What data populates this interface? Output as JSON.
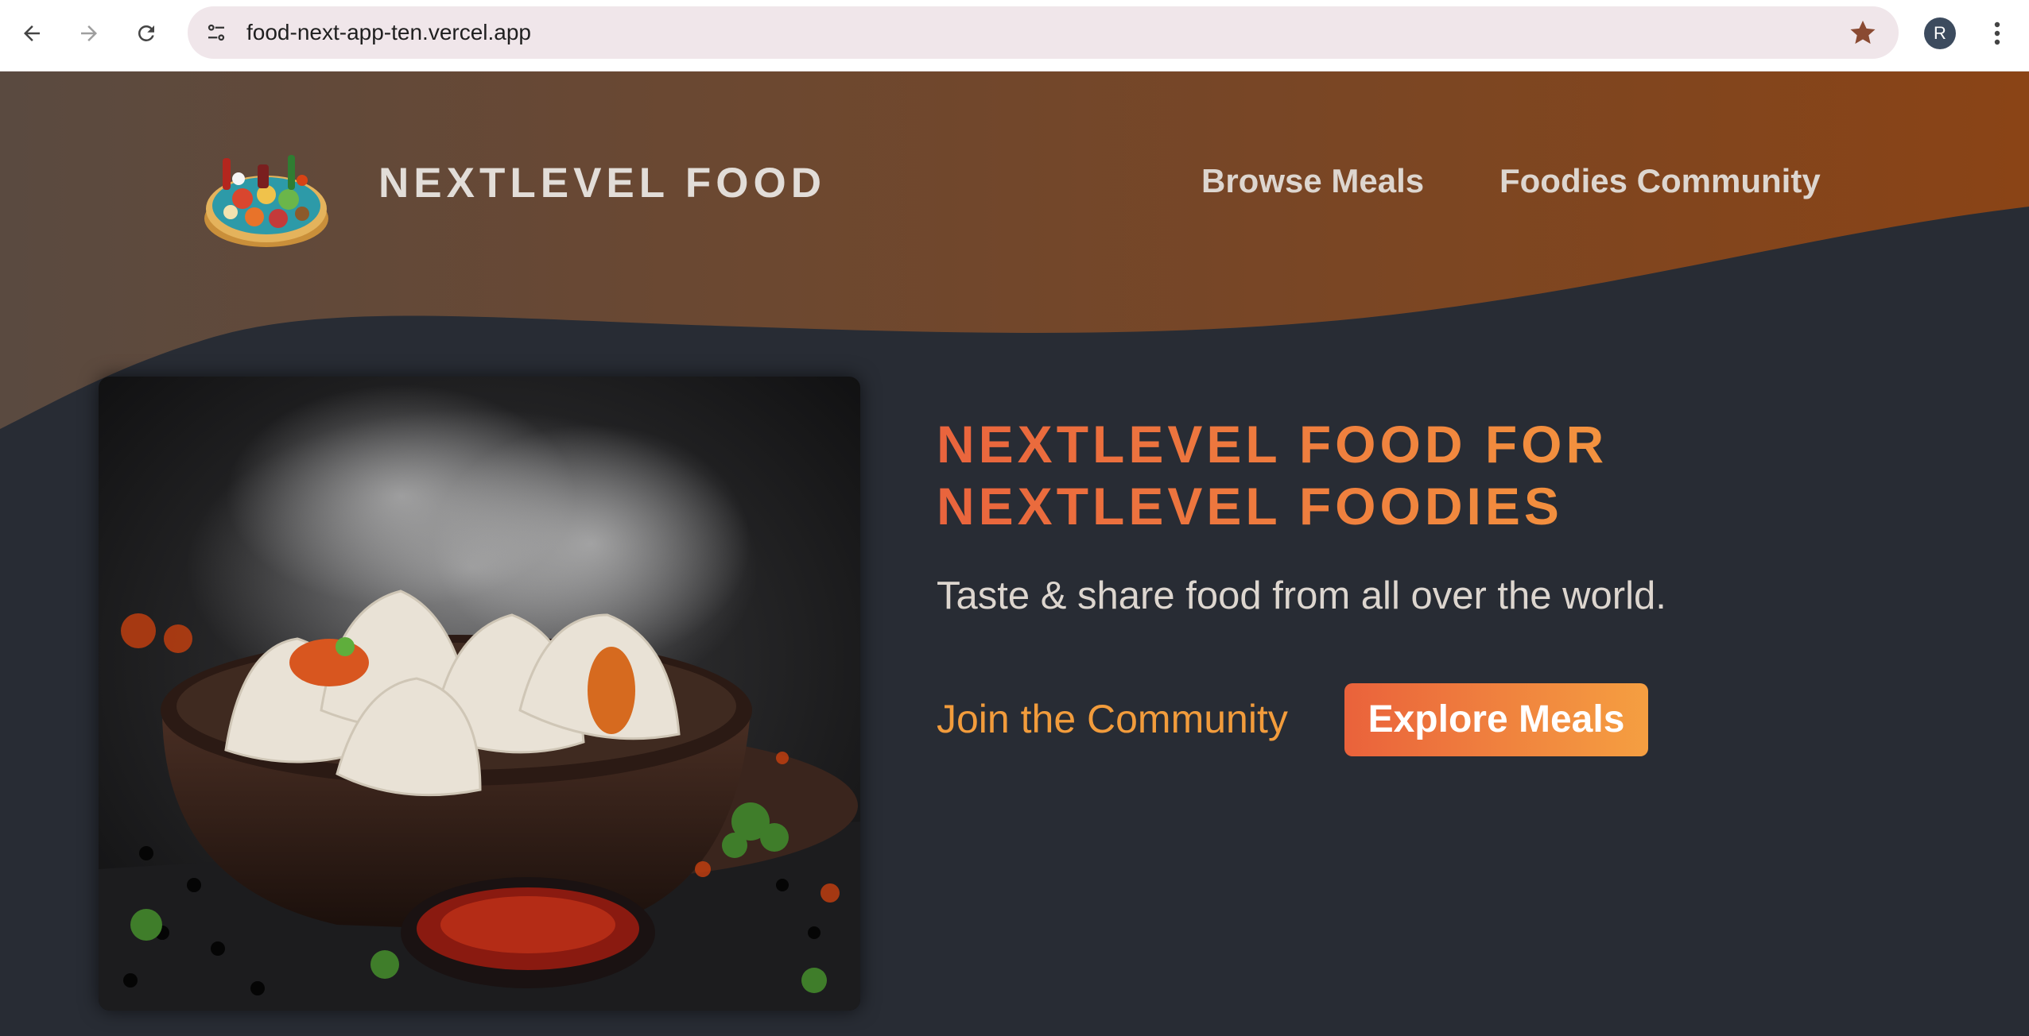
{
  "browser": {
    "url": "food-next-app-ten.vercel.app",
    "profile_initial": "R"
  },
  "header": {
    "site_title": "NEXTLEVEL FOOD",
    "nav": [
      {
        "label": "Browse Meals"
      },
      {
        "label": "Foodies Community"
      }
    ]
  },
  "hero": {
    "headline_line1": "NEXTLEVEL FOOD FOR",
    "headline_line2": "NEXTLEVEL FOODIES",
    "tagline": "Taste & share food from all over the world.",
    "join_link": "Join the Community",
    "explore_button": "Explore Meals"
  },
  "colors": {
    "page_bg": "#282c34",
    "header_gradient_start": "#5a4a40",
    "header_gradient_end": "#8a4416",
    "accent_orange": "#f29c3c",
    "button_gradient_start": "#ea623b",
    "button_gradient_end": "#f59f41"
  },
  "icons": {
    "back": "arrow-left-icon",
    "forward": "arrow-right-icon",
    "reload": "reload-icon",
    "site_info": "tune-icon",
    "bookmark": "star-icon",
    "menu": "kebab-menu-icon"
  }
}
